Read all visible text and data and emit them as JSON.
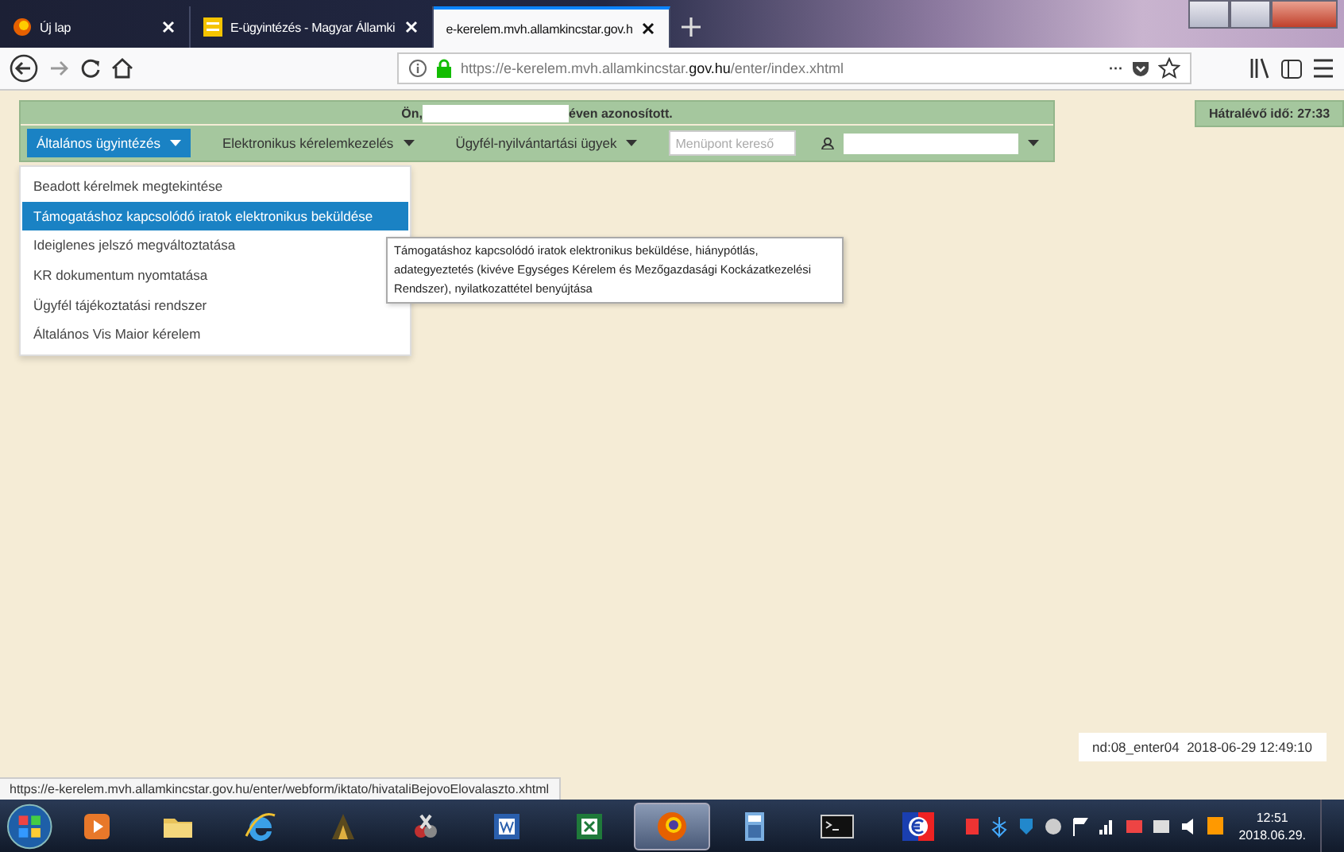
{
  "browser": {
    "tabs": [
      {
        "title": "Új lap",
        "selected": false,
        "kind": "firefox"
      },
      {
        "title": "E-ügyintézés - Magyar Államki",
        "selected": false,
        "kind": "page"
      },
      {
        "title": "e-kerelem.mvh.allamkincstar.gov.h",
        "selected": true,
        "kind": "blank"
      }
    ],
    "url_start": "https://e-kerelem.mvh.allamkincstar.",
    "url_domain": "gov.hu",
    "url_end": "/enter/index.xhtml",
    "more": "···"
  },
  "app": {
    "identity_prefix": "Ön,",
    "identity_suffix": "éven azonosított.",
    "remaining_time": "Hátralévő idő: 27:33",
    "menu": [
      {
        "label": "Általános ügyintézés",
        "selected": true
      },
      {
        "label": "Elektronikus kérelemkezelés",
        "selected": false
      },
      {
        "label": "Ügyfél-nyilvántartási ügyek",
        "selected": false
      }
    ],
    "search": {
      "placeholder": "Menüpont kereső"
    },
    "dropdown": [
      {
        "label": "Beadott kérelmek megtekintése",
        "selected": false
      },
      {
        "label": "Támogatáshoz kapcsolódó iratok elektronikus beküldése",
        "selected": true
      },
      {
        "label": "Ideiglenes jelszó megváltoztatása",
        "selected": false
      },
      {
        "label": "KR dokumentum nyomtatása",
        "selected": false
      },
      {
        "label": "Ügyfél tájékoztatási rendszer",
        "selected": false
      },
      {
        "label": "Általános Vis Maior kérelem",
        "selected": false
      }
    ],
    "tooltip": "Támogatáshoz kapcsolódó iratok elektronikus beküldése, hiánypótlás, adategyeztetés (kivéve Egységes Kérelem és Mezőgazdasági Kockázatkezelési Rendszer), nyilatkozattétel benyújtása",
    "server_info": "nd:08_enter04  2018-06-29 12:49:10"
  },
  "status_url": "https://e-kerelem.mvh.allamkincstar.gov.hu/enter/webform/iktato/hivataliBejovoElovalaszto.xhtml",
  "taskbar": {
    "apps": [
      {
        "kind": "media",
        "active": false
      },
      {
        "kind": "folder",
        "active": false
      },
      {
        "kind": "ie",
        "active": false
      },
      {
        "kind": "tool",
        "active": false
      },
      {
        "kind": "snip",
        "active": false
      },
      {
        "kind": "word",
        "active": false
      },
      {
        "kind": "excel",
        "active": false
      },
      {
        "kind": "firefox",
        "active": true
      },
      {
        "kind": "calc",
        "active": false
      },
      {
        "kind": "cmd",
        "active": false
      },
      {
        "kind": "euro",
        "active": false
      }
    ],
    "time": "12:51",
    "date": "2018.06.29."
  }
}
